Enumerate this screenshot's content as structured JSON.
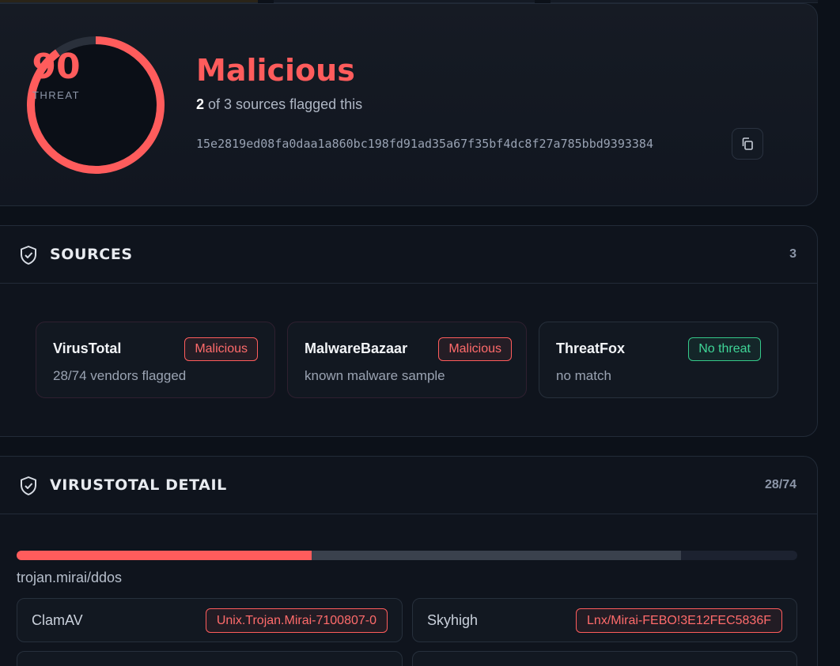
{
  "colors": {
    "danger": "#ff5c5c",
    "clean": "#35c98a",
    "background": "#0c1119",
    "card": "#0f141d",
    "undetected": "#3a414d"
  },
  "hero": {
    "score": "90",
    "score_value": 90,
    "score_label": "THREAT",
    "verdict": "Malicious",
    "flagged_count": "2",
    "flagged_suffix": "of 3 sources flagged this",
    "hash": "15e2819ed08fa0daa1a860bc198fd91ad35a67f35bf4dc8f27a785bbd9393384",
    "copy_icon": "copy-icon"
  },
  "sources": {
    "title": "SOURCES",
    "count": "3",
    "icon": "shield-check-icon",
    "items": [
      {
        "name": "VirusTotal",
        "badge": "Malicious",
        "desc": "28/74 vendors flagged"
      },
      {
        "name": "MalwareBazaar",
        "badge": "Malicious",
        "desc": "known malware sample"
      },
      {
        "name": "ThreatFox",
        "badge": "No threat",
        "desc": "no match"
      }
    ]
  },
  "virustotal": {
    "title": "VIRUSTOTAL DETAIL",
    "count": "28/74",
    "icon": "shield-check-icon",
    "malicious_fraction": 0.378,
    "undetected_end_fraction": 0.851,
    "label": "trojan.mirai/ddos",
    "vendors": [
      {
        "name": "ClamAV",
        "result": "Unix.Trojan.Mirai-7100807-0"
      },
      {
        "name": "Skyhigh",
        "result": "Lnx/Mirai-FEBO!3E12FEC5836F"
      }
    ]
  }
}
